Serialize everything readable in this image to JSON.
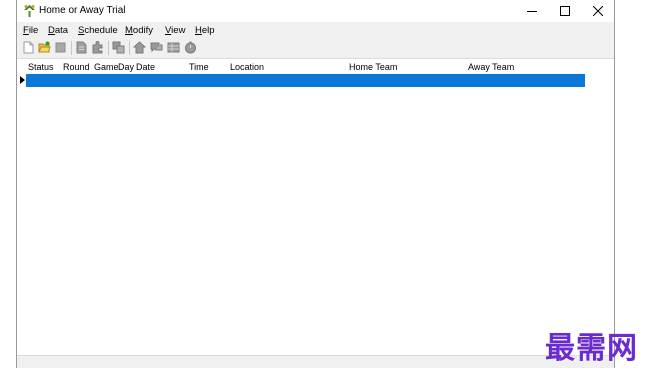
{
  "window": {
    "title": "Home or Away Trial"
  },
  "menu": [
    {
      "accel": "F",
      "rest": "ile"
    },
    {
      "accel": "D",
      "rest": "ata"
    },
    {
      "accel": "S",
      "rest": "chedule"
    },
    {
      "accel": "M",
      "rest": "odify"
    },
    {
      "accel": "V",
      "rest": "iew"
    },
    {
      "accel": "H",
      "rest": "elp"
    }
  ],
  "toolbar_icons": [
    "new-file-icon",
    "open-folder-icon",
    "stop-icon",
    "document-icon",
    "puzzle-icon",
    "copy-icon",
    "home-icon",
    "chat-icon",
    "grid-icon",
    "clock-icon"
  ],
  "grid": {
    "headers": [
      "Status",
      "Round",
      "Game",
      "Day",
      "Date",
      "Time",
      "Location",
      "Home Team",
      "Away Team"
    ]
  },
  "colors": {
    "selection": "#0a78d7"
  },
  "watermark": "最需网"
}
